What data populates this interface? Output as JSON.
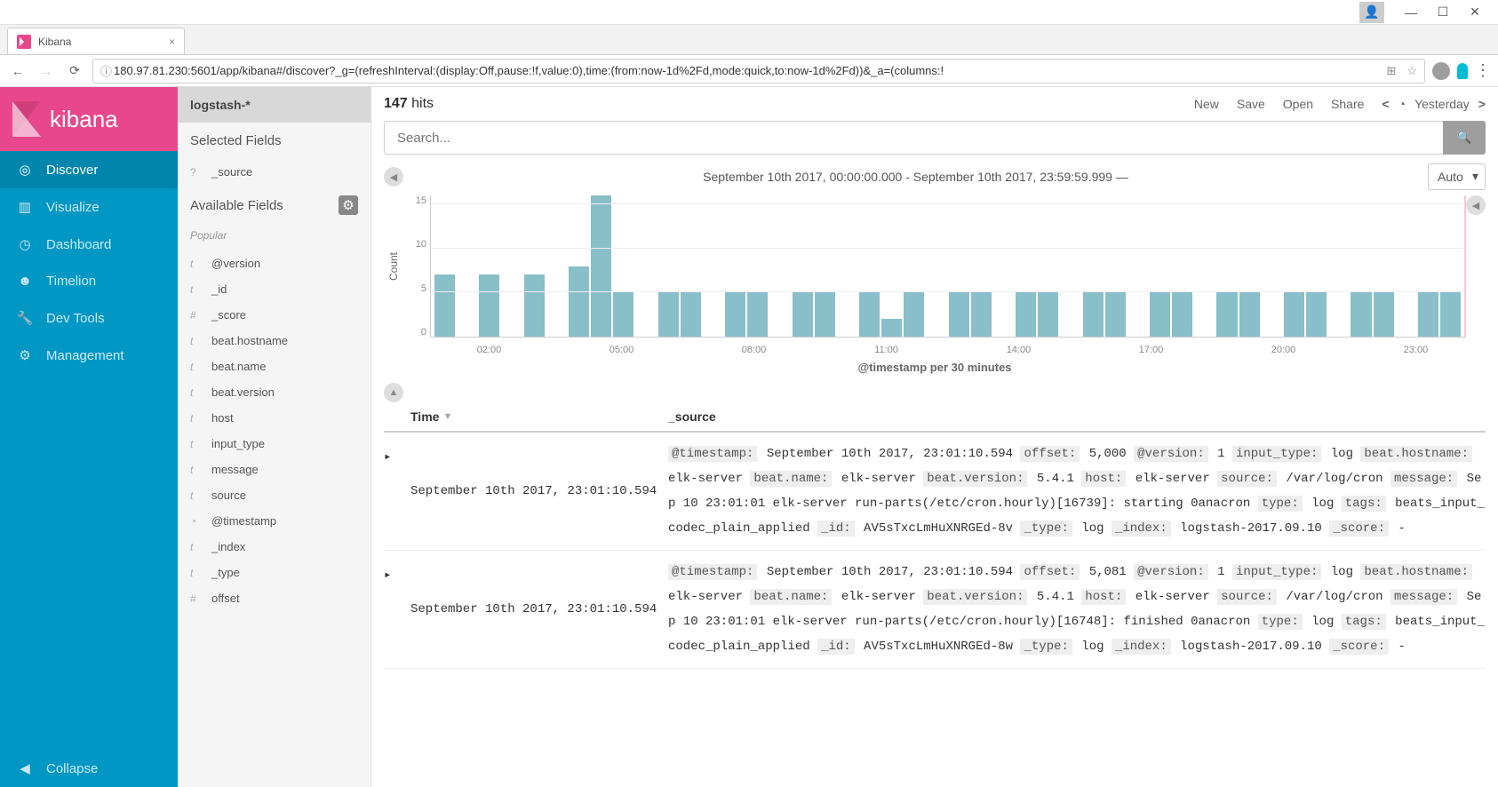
{
  "browser": {
    "tab_title": "Kibana",
    "url_info_icon": "ⓘ",
    "url": "180.97.81.230:5601/app/kibana#/discover?_g=(refreshInterval:(display:Off,pause:!f,value:0),time:(from:now-1d%2Fd,mode:quick,to:now-1d%2Fd))&_a=(columns:!"
  },
  "logo_text": "kibana",
  "nav": {
    "discover": "Discover",
    "visualize": "Visualize",
    "dashboard": "Dashboard",
    "timelion": "Timelion",
    "devtools": "Dev Tools",
    "management": "Management",
    "collapse": "Collapse"
  },
  "fields": {
    "index": "logstash-*",
    "selected_title": "Selected Fields",
    "selected": [
      {
        "t": "q",
        "n": "_source"
      }
    ],
    "available_title": "Available Fields",
    "popular_title": "Popular",
    "popular": [
      {
        "t": "t",
        "n": "@version"
      },
      {
        "t": "t",
        "n": "_id"
      },
      {
        "t": "hash",
        "n": "_score"
      },
      {
        "t": "t",
        "n": "beat.hostname"
      },
      {
        "t": "t",
        "n": "beat.name"
      },
      {
        "t": "t",
        "n": "beat.version"
      },
      {
        "t": "t",
        "n": "host"
      },
      {
        "t": "t",
        "n": "input_type"
      },
      {
        "t": "t",
        "n": "message"
      },
      {
        "t": "t",
        "n": "source"
      },
      {
        "t": "clock",
        "n": "@timestamp"
      },
      {
        "t": "t",
        "n": "_index"
      },
      {
        "t": "t",
        "n": "_type"
      },
      {
        "t": "hash",
        "n": "offset"
      }
    ]
  },
  "topbar": {
    "hit_count": "147",
    "hit_label": " hits",
    "new": "New",
    "save": "Save",
    "open": "Open",
    "share": "Share",
    "time_label": "Yesterday"
  },
  "search": {
    "placeholder": "Search...",
    "icon": "🔍"
  },
  "chart_header": {
    "range": "September 10th 2017, 00:00:00.000 - September 10th 2017, 23:59:59.999 —",
    "interval": "Auto"
  },
  "chart_data": {
    "type": "bar",
    "ylabel": "Count",
    "xlabel": "@timestamp per 30 minutes",
    "yticks": [
      "15",
      "10",
      "5",
      "0"
    ],
    "ylim": [
      0,
      16
    ],
    "xticks": [
      "02:00",
      "05:00",
      "08:00",
      "11:00",
      "14:00",
      "17:00",
      "20:00",
      "23:00"
    ],
    "values": [
      7,
      0,
      7,
      0,
      7,
      0,
      8,
      16,
      5,
      0,
      5,
      5,
      0,
      5,
      5,
      0,
      5,
      5,
      0,
      5,
      2,
      5,
      0,
      5,
      5,
      0,
      5,
      5,
      0,
      5,
      5,
      0,
      5,
      5,
      0,
      5,
      5,
      0,
      5,
      5,
      0,
      5,
      5,
      0,
      5,
      5
    ]
  },
  "table": {
    "col_time": "Time",
    "col_source": "_source",
    "rows": [
      {
        "time": "September 10th 2017, 23:01:10.594",
        "kv": [
          [
            "@timestamp:",
            "September 10th 2017, 23:01:10.594"
          ],
          [
            "offset:",
            "5,000"
          ],
          [
            "@version:",
            "1"
          ],
          [
            "input_type:",
            "log"
          ],
          [
            "beat.hostname:",
            "elk-server"
          ],
          [
            "beat.name:",
            "elk-server"
          ],
          [
            "beat.version:",
            "5.4.1"
          ],
          [
            "host:",
            "elk-server"
          ],
          [
            "source:",
            "/var/log/cron"
          ],
          [
            "message:",
            "Sep 10 23:01:01 elk-server run-parts(/etc/cron.hourly)[16739]: starting 0anacron"
          ],
          [
            "type:",
            "log"
          ],
          [
            "tags:",
            "beats_input_codec_plain_applied"
          ],
          [
            "_id:",
            "AV5sTxcLmHuXNRGEd-8v"
          ],
          [
            "_type:",
            "log"
          ],
          [
            "_index:",
            "logstash-2017.09.10"
          ],
          [
            "_score:",
            " - "
          ]
        ]
      },
      {
        "time": "September 10th 2017, 23:01:10.594",
        "kv": [
          [
            "@timestamp:",
            "September 10th 2017, 23:01:10.594"
          ],
          [
            "offset:",
            "5,081"
          ],
          [
            "@version:",
            "1"
          ],
          [
            "input_type:",
            "log"
          ],
          [
            "beat.hostname:",
            "elk-server"
          ],
          [
            "beat.name:",
            "elk-server"
          ],
          [
            "beat.version:",
            "5.4.1"
          ],
          [
            "host:",
            "elk-server"
          ],
          [
            "source:",
            "/var/log/cron"
          ],
          [
            "message:",
            "Sep 10 23:01:01 elk-server run-parts(/etc/cron.hourly)[16748]: finished 0anacron"
          ],
          [
            "type:",
            "log"
          ],
          [
            "tags:",
            "beats_input_codec_plain_applied"
          ],
          [
            "_id:",
            "AV5sTxcLmHuXNRGEd-8w"
          ],
          [
            "_type:",
            "log"
          ],
          [
            "_index:",
            "logstash-2017.09.10"
          ],
          [
            "_score:",
            " - "
          ]
        ]
      }
    ]
  }
}
